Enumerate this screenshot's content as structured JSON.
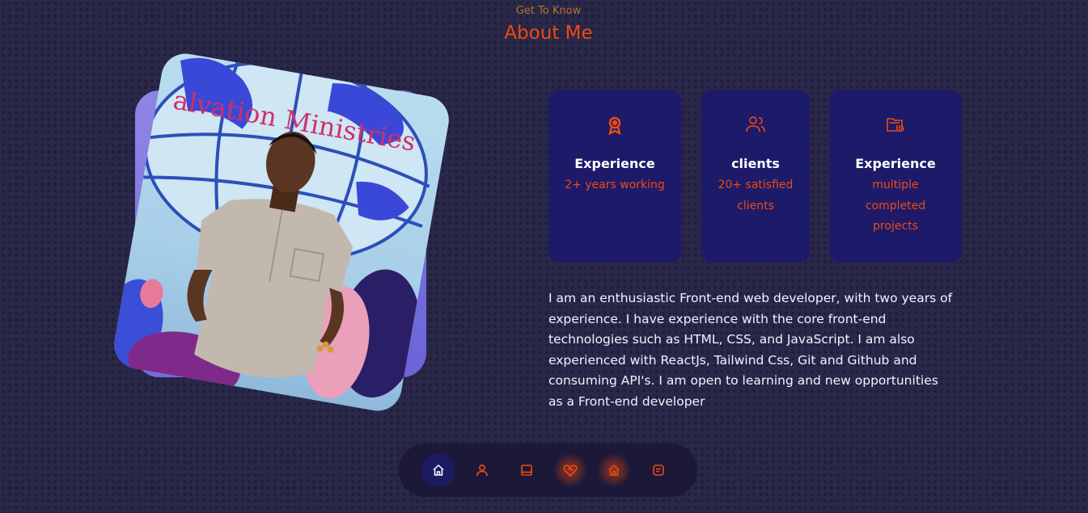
{
  "section": {
    "eyebrow": "Get To Know",
    "title": "About Me"
  },
  "photo": {
    "sign_text": "alvation Ministries"
  },
  "stats": [
    {
      "icon": "award-icon",
      "title": "Experience",
      "desc": "2+ years working"
    },
    {
      "icon": "users-icon",
      "title": "clients",
      "desc": "20+ satisfied clients"
    },
    {
      "icon": "folder-icon",
      "title": "Experience",
      "desc": "multiple completed projects"
    }
  ],
  "about": {
    "text": "I am an enthusiastic Front-end web developer, with two years of experience. I have experience with the core front-end technologies such as HTML, CSS, and JavaScript. I am also experienced with ReactJs, Tailwind Css, Git and Github and consuming API's. I am open to learning and new opportunities as a Front-end developer"
  },
  "nav": {
    "items": [
      {
        "icon": "home-icon",
        "active": true
      },
      {
        "icon": "user-icon",
        "active": false
      },
      {
        "icon": "book-icon",
        "active": false
      },
      {
        "icon": "heart-handshake-icon",
        "active": false
      },
      {
        "icon": "home-icon",
        "active": false
      },
      {
        "icon": "message-square-icon",
        "active": false
      }
    ]
  },
  "colors": {
    "accent": "#ef4b10",
    "card_bg": "#1d1a6a",
    "page_bg": "#2a2849",
    "nav_bg": "#1b1838"
  }
}
